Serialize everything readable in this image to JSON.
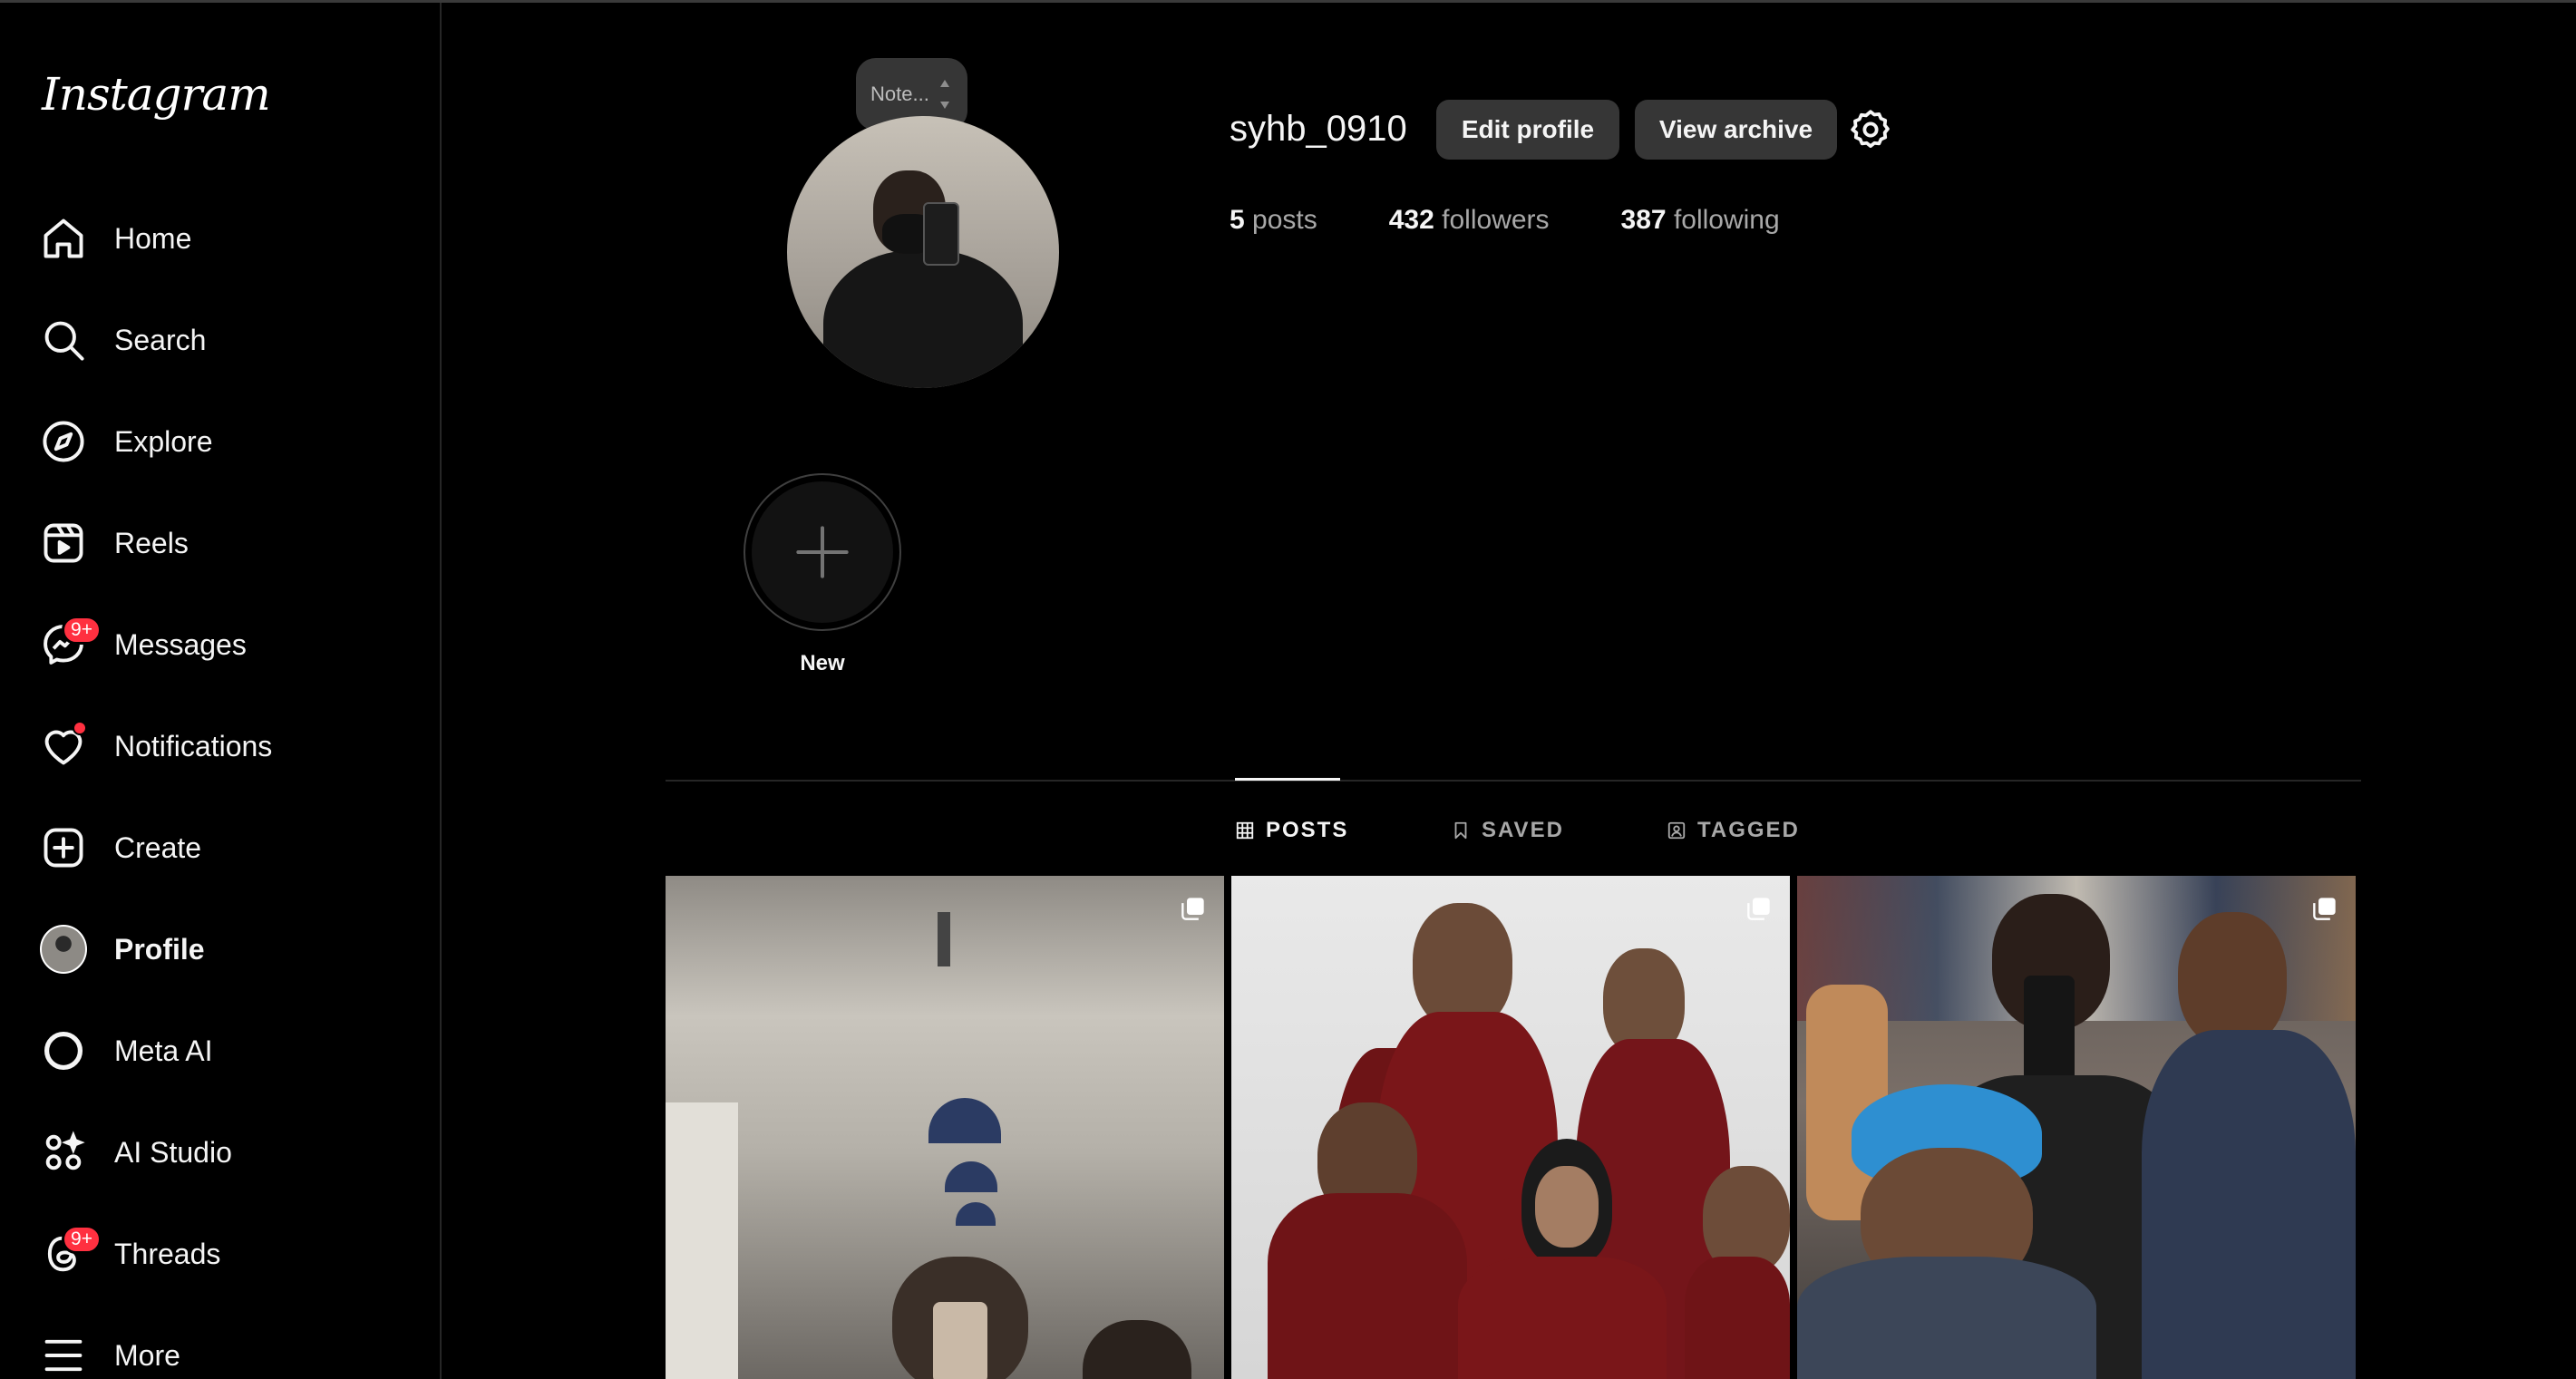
{
  "app": {
    "logo_text": "Instagram"
  },
  "sidebar": {
    "items": [
      {
        "label": "Home",
        "icon": "home-icon"
      },
      {
        "label": "Search",
        "icon": "search-icon"
      },
      {
        "label": "Explore",
        "icon": "compass-icon"
      },
      {
        "label": "Reels",
        "icon": "reels-icon"
      },
      {
        "label": "Messages",
        "icon": "messenger-icon",
        "badge": "9+"
      },
      {
        "label": "Notifications",
        "icon": "heart-icon",
        "dot": true
      },
      {
        "label": "Create",
        "icon": "plus-square-icon"
      },
      {
        "label": "Profile",
        "icon": "avatar",
        "active": true
      },
      {
        "label": "Meta AI",
        "icon": "meta-ai-icon"
      },
      {
        "label": "AI Studio",
        "icon": "ai-studio-icon"
      },
      {
        "label": "Threads",
        "icon": "threads-icon",
        "badge": "9+"
      },
      {
        "label": "More",
        "icon": "menu-icon"
      }
    ]
  },
  "profile": {
    "note_placeholder": "Note...",
    "username": "syhb_0910",
    "edit_profile_label": "Edit profile",
    "view_archive_label": "View archive",
    "stats": {
      "posts_count": "5",
      "posts_label": "posts",
      "followers_count": "432",
      "followers_label": "followers",
      "following_count": "387",
      "following_label": "following"
    }
  },
  "highlights": {
    "new_label": "New"
  },
  "tabs": [
    {
      "label": "POSTS",
      "icon": "grid-icon",
      "active": true
    },
    {
      "label": "SAVED",
      "icon": "bookmark-icon"
    },
    {
      "label": "TAGGED",
      "icon": "tag-user-icon"
    }
  ],
  "colors": {
    "background": "#000000",
    "badge": "#ff3040",
    "button": "#363636"
  }
}
